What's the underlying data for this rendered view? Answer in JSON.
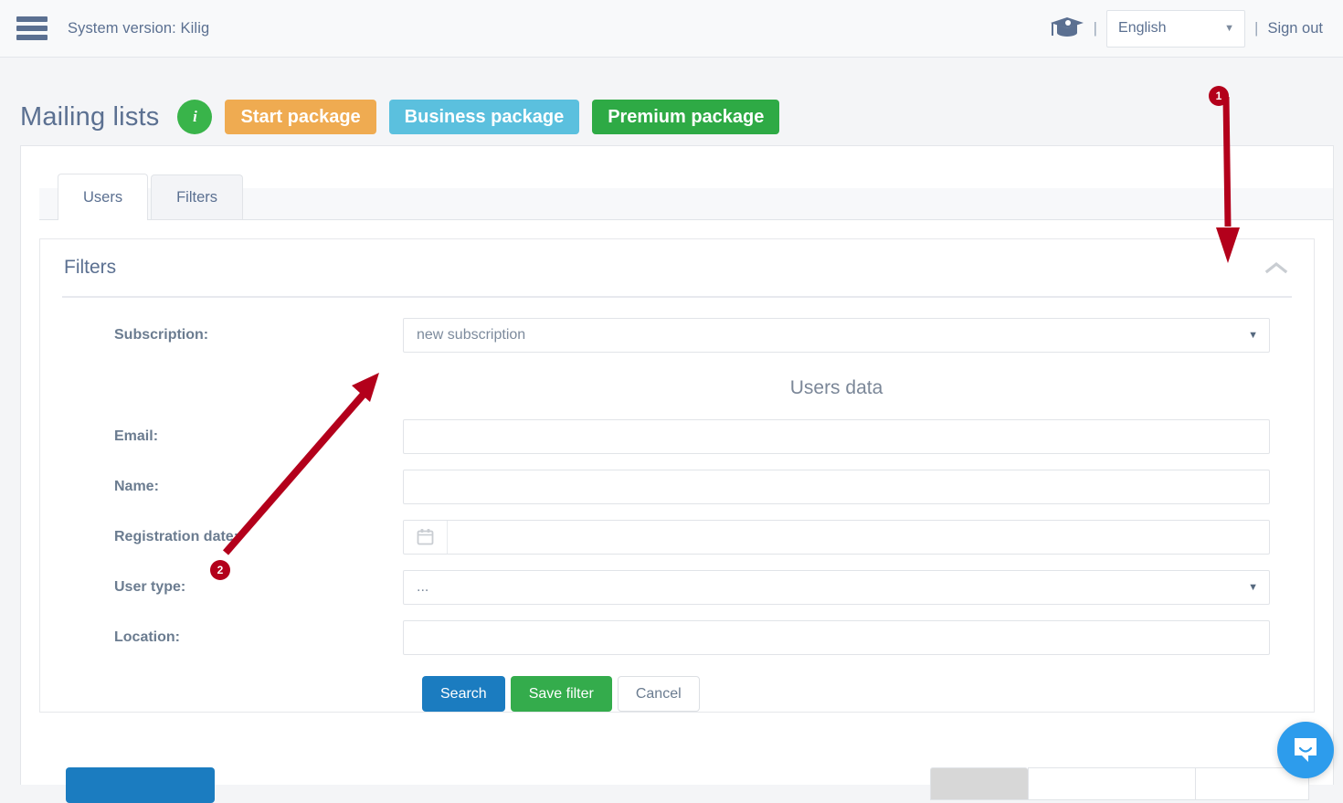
{
  "topbar": {
    "menu_icon": "hamburger-icon",
    "system_version": "System version: Kilig",
    "cap_icon": "graduation-cap-icon",
    "separator": "|",
    "language": "English",
    "language_caret": "▼",
    "sign_out": "Sign out"
  },
  "header": {
    "title": "Mailing lists",
    "info_badge": "i",
    "packages": [
      {
        "label": "Start package",
        "color": "#efab51"
      },
      {
        "label": "Business package",
        "color": "#5bc0de"
      },
      {
        "label": "Premium package",
        "color": "#2eaa45"
      }
    ]
  },
  "tabs": [
    {
      "label": "Users",
      "active": true
    },
    {
      "label": "Filters",
      "active": false
    }
  ],
  "panel": {
    "title": "Filters",
    "collapse_icon": "chevron-up-icon",
    "section_heading": "Users data",
    "fields": {
      "subscription": {
        "label": "Subscription:",
        "value": "new subscription",
        "caret": "▼"
      },
      "email": {
        "label": "Email:",
        "value": "",
        "placeholder": ""
      },
      "name": {
        "label": "Name:",
        "value": "",
        "placeholder": ""
      },
      "registration_date": {
        "label": "Registration date:",
        "value": "",
        "placeholder": "",
        "icon": "calendar-icon"
      },
      "user_type": {
        "label": "User type:",
        "value": "...",
        "caret": "▼"
      },
      "location": {
        "label": "Location:",
        "value": "",
        "placeholder": ""
      }
    },
    "buttons": {
      "search": "Search",
      "save_filter": "Save filter",
      "cancel": "Cancel"
    }
  },
  "annotations": [
    {
      "number": "1"
    },
    {
      "number": "2"
    }
  ],
  "chat": {
    "icon": "chat-bubble-icon"
  },
  "colors": {
    "accent_blue": "#1b7cc0",
    "accent_green": "#34ac4c",
    "annotation_red": "#b3001b",
    "chat_blue": "#2d9cec",
    "text": "#5b7091"
  }
}
